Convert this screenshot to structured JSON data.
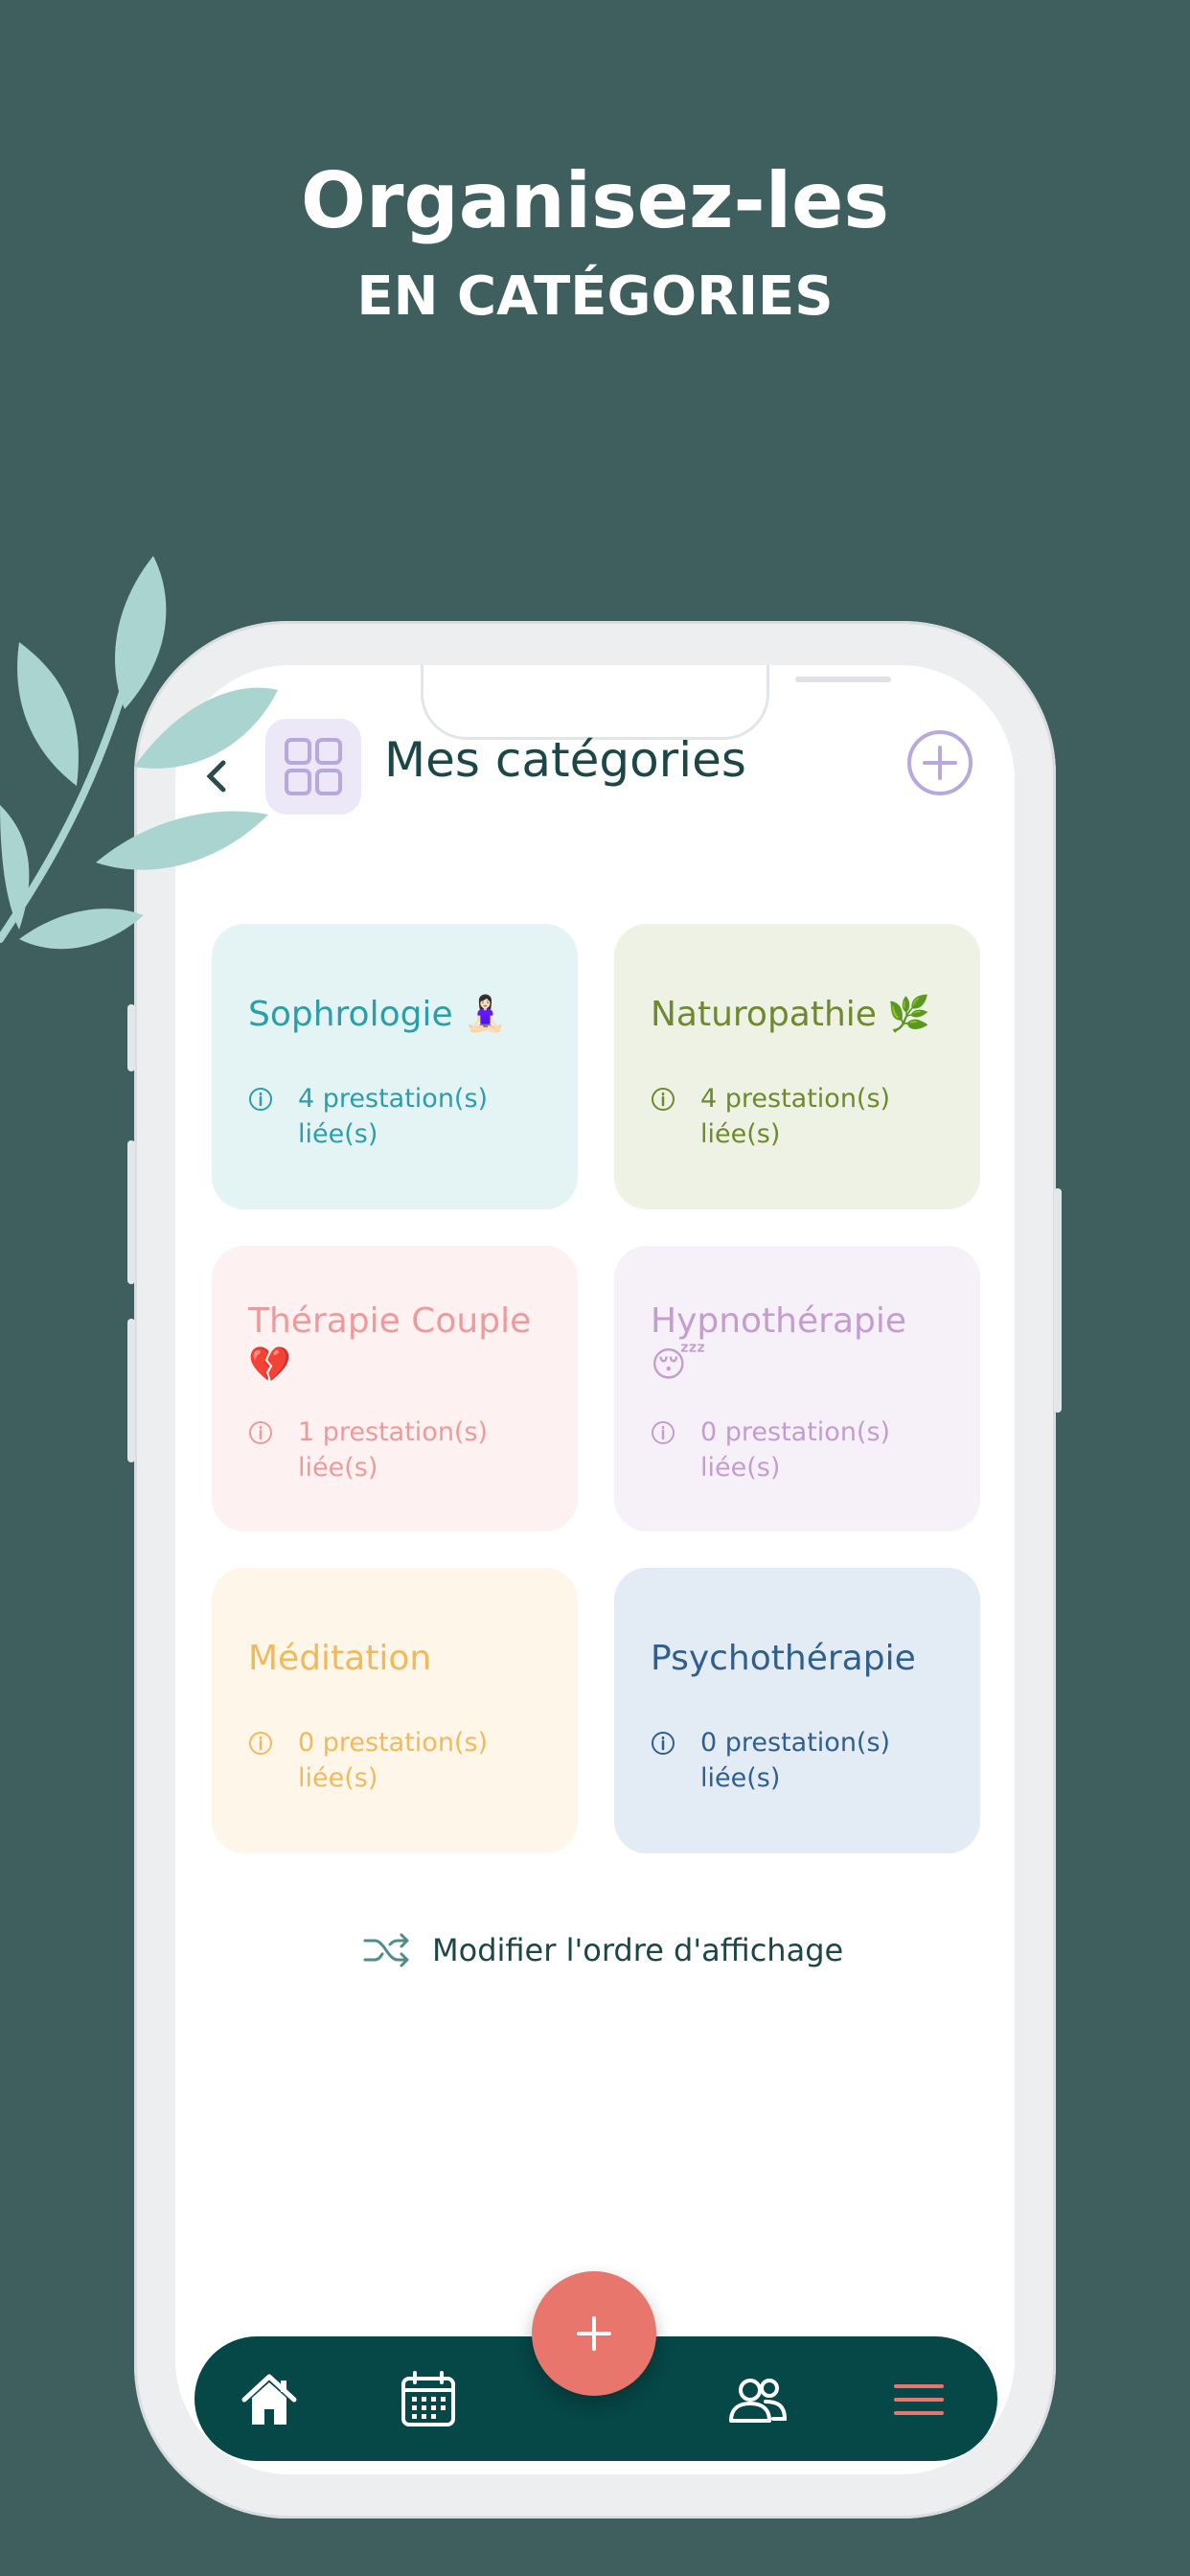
{
  "headline": {
    "title": "Organisez-les",
    "subtitle": "EN CATÉGORIES"
  },
  "colors": {
    "background": "#3f5f5e",
    "brand_dark": "#064747",
    "accent_coral": "#e8766c",
    "accent_lavender": "#b8a8dc"
  },
  "screen": {
    "title": "Mes catégories",
    "back_icon": "chevron-left-icon",
    "title_icon": "grid-icon",
    "add_icon": "plus-circle-icon"
  },
  "categories": [
    {
      "name": "Sophrologie 🧘🏻‍♀️",
      "count": "4 prestation(s) liée(s)",
      "bg": "#e4f4f4",
      "fg": "#2a9ea9"
    },
    {
      "name": "Naturopathie 🌿",
      "count": "4 prestation(s) liée(s)",
      "bg": "#eef2e4",
      "fg": "#6d8a2c"
    },
    {
      "name": "Thérapie Couple 💔",
      "count": "1 prestation(s) liée(s)",
      "bg": "#fdf1f1",
      "fg": "#ee9a9a"
    },
    {
      "name": "Hypnothérapie 😴",
      "count": "0 prestation(s) liée(s)",
      "bg": "#f6f1f8",
      "fg": "#c49cd0"
    },
    {
      "name": "Méditation",
      "count": "0 prestation(s) liée(s)",
      "bg": "#fef6e8",
      "fg": "#f2b95c"
    },
    {
      "name": "Psychothérapie",
      "count": "0 prestation(s) liée(s)",
      "bg": "#e3ebf4",
      "fg": "#2f5f8f"
    }
  ],
  "reorder": {
    "label": "Modifier l'ordre d'affichage",
    "icon": "shuffle-icon"
  },
  "tabbar": {
    "items": [
      "home-icon",
      "calendar-icon",
      "clients-icon",
      "menu-icon"
    ],
    "fab_icon": "plus-icon",
    "fab_label": "+"
  }
}
